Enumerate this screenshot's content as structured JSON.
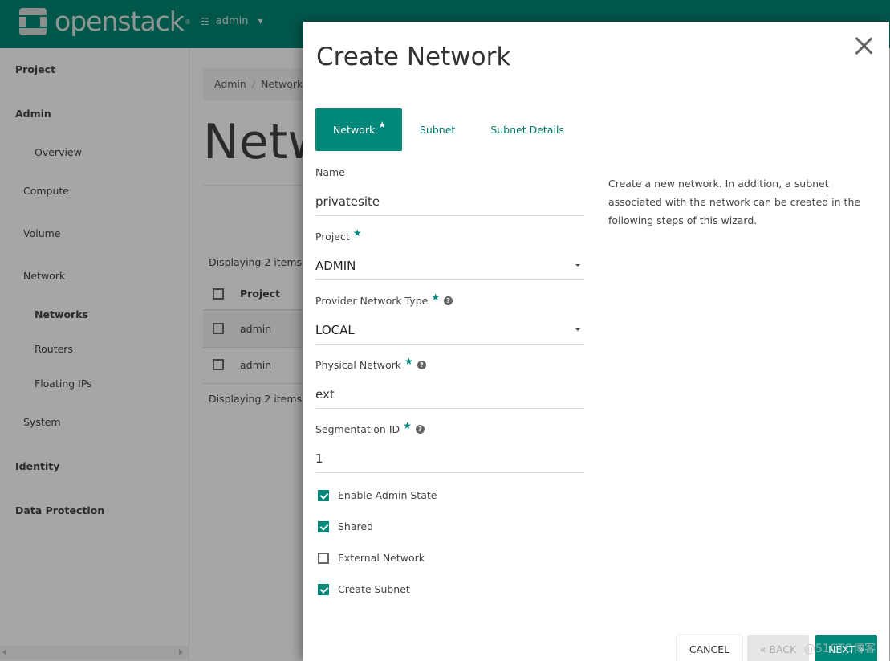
{
  "navbar": {
    "brand": "openstack",
    "brand_mark": "®",
    "project_switcher": "admin",
    "colors": {
      "navbar_bg": "#02574b",
      "accent": "#00897b"
    }
  },
  "sidebar": {
    "items": [
      {
        "label": "Project",
        "level": 0
      },
      {
        "label": "Admin",
        "level": 0
      },
      {
        "label": "Overview",
        "level": 2
      },
      {
        "label": "Compute",
        "level": 1
      },
      {
        "label": "Volume",
        "level": 1
      },
      {
        "label": "Network",
        "level": 1
      },
      {
        "label": "Networks",
        "level": 2,
        "active": true
      },
      {
        "label": "Routers",
        "level": 2
      },
      {
        "label": "Floating IPs",
        "level": 2
      },
      {
        "label": "System",
        "level": 1
      },
      {
        "label": "Identity",
        "level": 0
      },
      {
        "label": "Data Protection",
        "level": 0
      }
    ]
  },
  "main": {
    "breadcrumb": [
      "Admin",
      "Network"
    ],
    "breadcrumb_sep": "/",
    "page_title": "Networks",
    "display_count_top": "Displaying 2 items",
    "display_count_bottom": "Displaying 2 items",
    "table": {
      "columns": [
        "Project"
      ],
      "rows": [
        {
          "project": "admin"
        },
        {
          "project": "admin"
        }
      ]
    }
  },
  "modal": {
    "title": "Create Network",
    "close_label": "×",
    "tabs": [
      {
        "label": "Network",
        "active": true,
        "required": true
      },
      {
        "label": "Subnet",
        "active": false
      },
      {
        "label": "Subnet Details",
        "active": false
      }
    ],
    "fields": {
      "name": {
        "label": "Name",
        "value": "privatesite"
      },
      "project": {
        "label": "Project",
        "value": "ADMIN",
        "required": true
      },
      "provider_network_type": {
        "label": "Provider Network Type",
        "value": "LOCAL",
        "required": true,
        "help": "?"
      },
      "physical_network": {
        "label": "Physical Network",
        "value": "ext",
        "required": true,
        "help": "?"
      },
      "segmentation_id": {
        "label": "Segmentation ID",
        "value": "1",
        "required": true,
        "help": "?"
      }
    },
    "checkboxes": [
      {
        "label": "Enable Admin State",
        "checked": true
      },
      {
        "label": "Shared",
        "checked": true
      },
      {
        "label": "External Network",
        "checked": false
      },
      {
        "label": "Create Subnet",
        "checked": true
      }
    ],
    "help_text": "Create a new network. In addition, a subnet associated with the network can be created in the following steps of this wizard.",
    "buttons": {
      "cancel": "CANCEL",
      "back": "« BACK",
      "next": "NEXT »"
    },
    "required_star": "★",
    "watermark": "@51CTO博客"
  }
}
